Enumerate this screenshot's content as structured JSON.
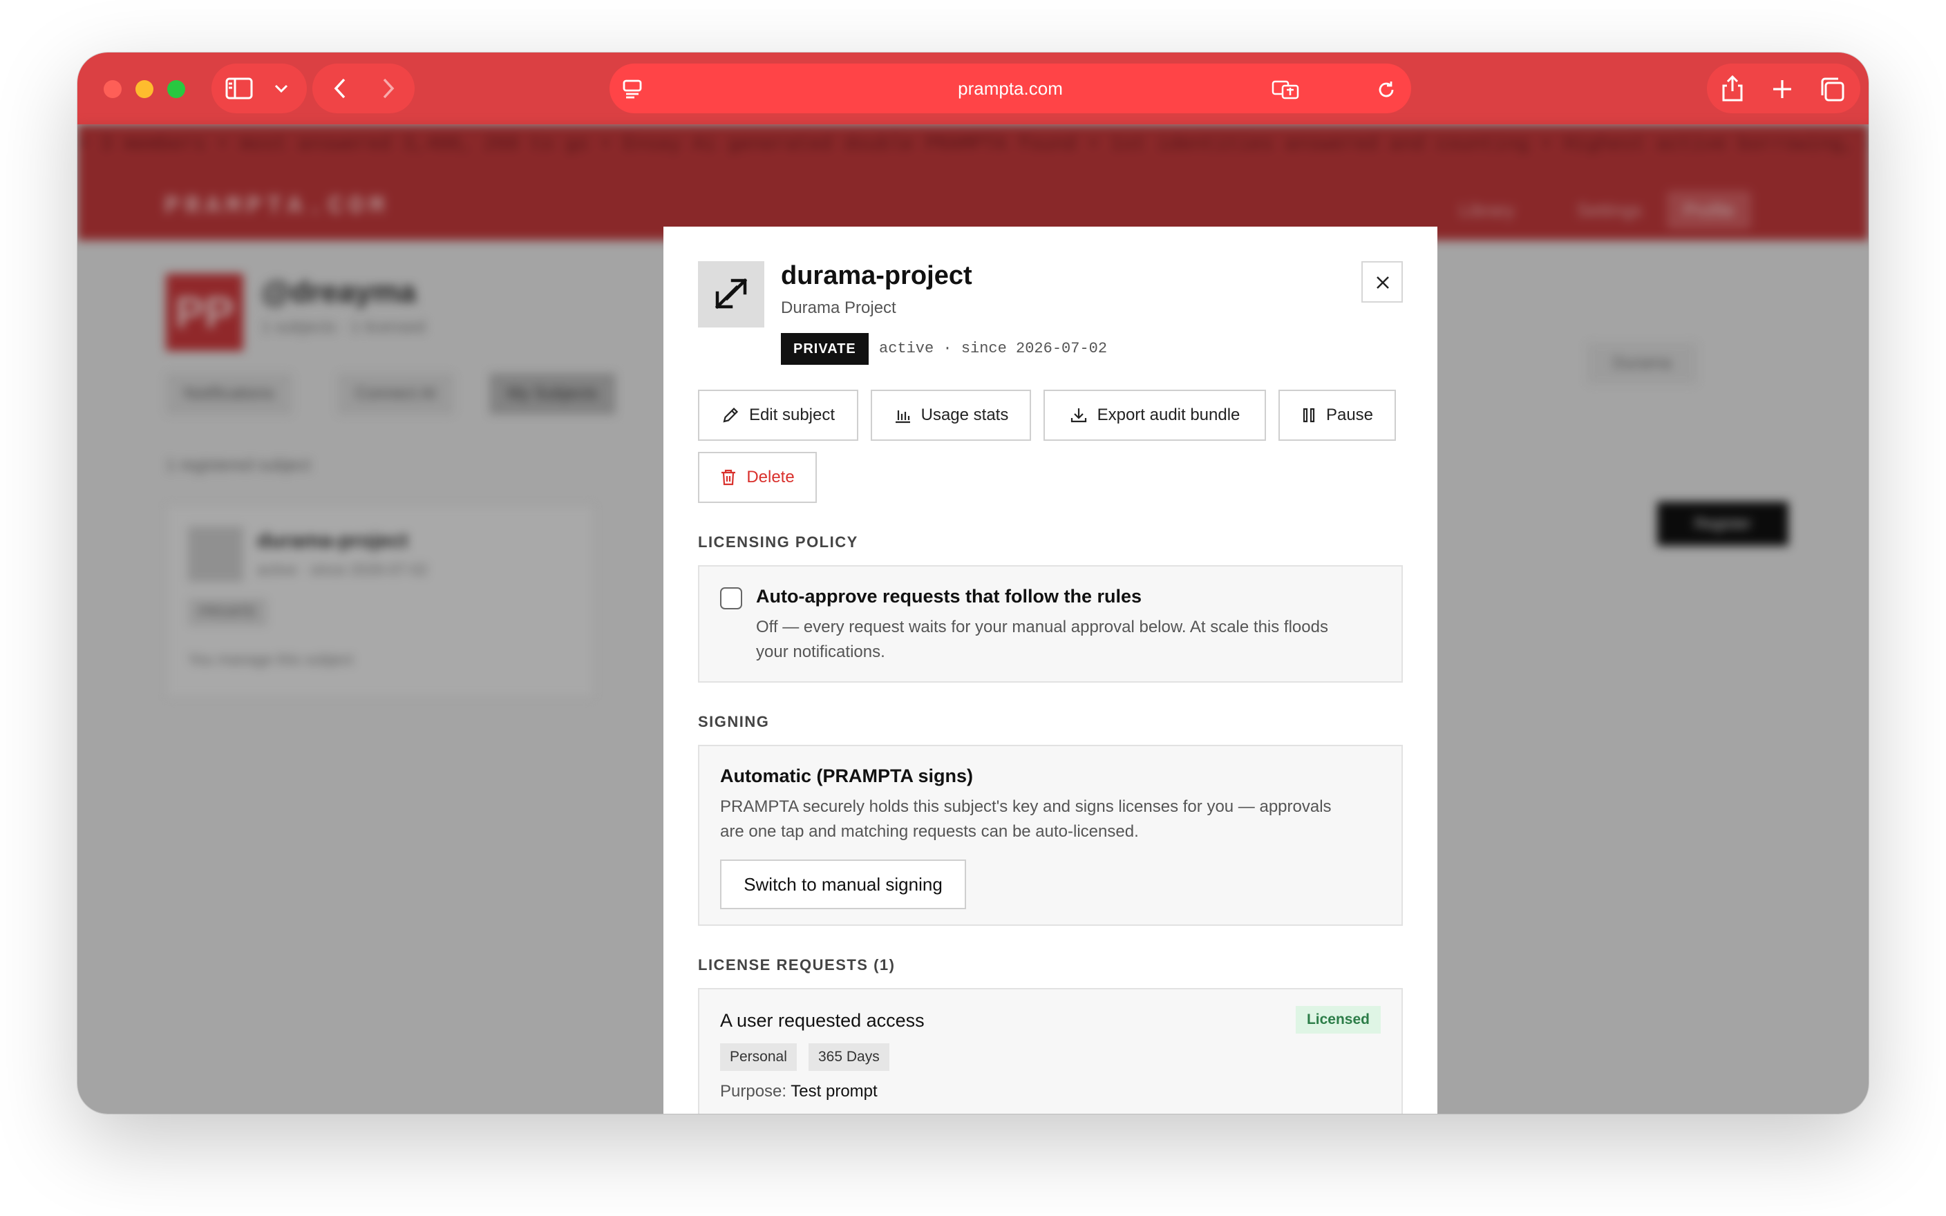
{
  "browser": {
    "url": "prampta.com",
    "colors": {
      "chrome": "#db4043",
      "url_field": "#ff4447"
    }
  },
  "site": {
    "ticker_text": "• 3 members • most answered 3,400, 260 to go • Ensay Ai generated double PRAMPTA found • 1st identities answered and counting • Highest active borrowing, decisions on every speed",
    "logo": "PRAMPTA.COM",
    "nav": [
      "Library",
      "Settings",
      "Profile"
    ],
    "avatar_initials": "PP",
    "username": "@dreayma",
    "user_stats": "1 subjects · 1 licensed",
    "tabs": [
      "Notifications",
      "Connect AI",
      "My Subjects"
    ],
    "section_count": "1 registered subject",
    "register_button": "Register",
    "subject_card": {
      "name": "durama-project",
      "meta": "active · since 2026-07-02",
      "tag": "PRIVATE",
      "note": "You manage this subject"
    },
    "toolbar_button": "Durama"
  },
  "modal": {
    "title": "durama-project",
    "subtitle": "Durama Project",
    "visibility_badge": "PRIVATE",
    "status": "active · since 2026-07-02",
    "actions": {
      "edit": "Edit subject",
      "usage": "Usage stats",
      "export": "Export audit bundle",
      "pause": "Pause",
      "delete": "Delete"
    },
    "licensing": {
      "section_title": "LICENSING POLICY",
      "checkbox_label": "Auto-approve requests that follow the rules",
      "checked": false,
      "description_line1": "Off — every request waits for your manual approval below. At scale this floods",
      "description_line2": "your notifications."
    },
    "signing": {
      "section_title": "SIGNING",
      "mode": "Automatic (PRAMPTA signs)",
      "description_line1": "PRAMPTA securely holds this subject's key and signs licenses for you — approvals",
      "description_line2": "are one tap and matching requests can be auto-licensed.",
      "switch_button": "Switch to manual signing"
    },
    "requests": {
      "section_title": "LICENSE REQUESTS (1)",
      "items": [
        {
          "title": "A user requested access",
          "status": "Licensed",
          "tags": [
            "Personal",
            "365 Days"
          ],
          "purpose_label": "Purpose:",
          "purpose_value": "Test prompt"
        }
      ]
    }
  },
  "colors": {
    "danger": "#d9302c",
    "licensed_bg": "#dff5e5",
    "licensed_text": "#2c7d48",
    "badge_bg": "#111111"
  }
}
